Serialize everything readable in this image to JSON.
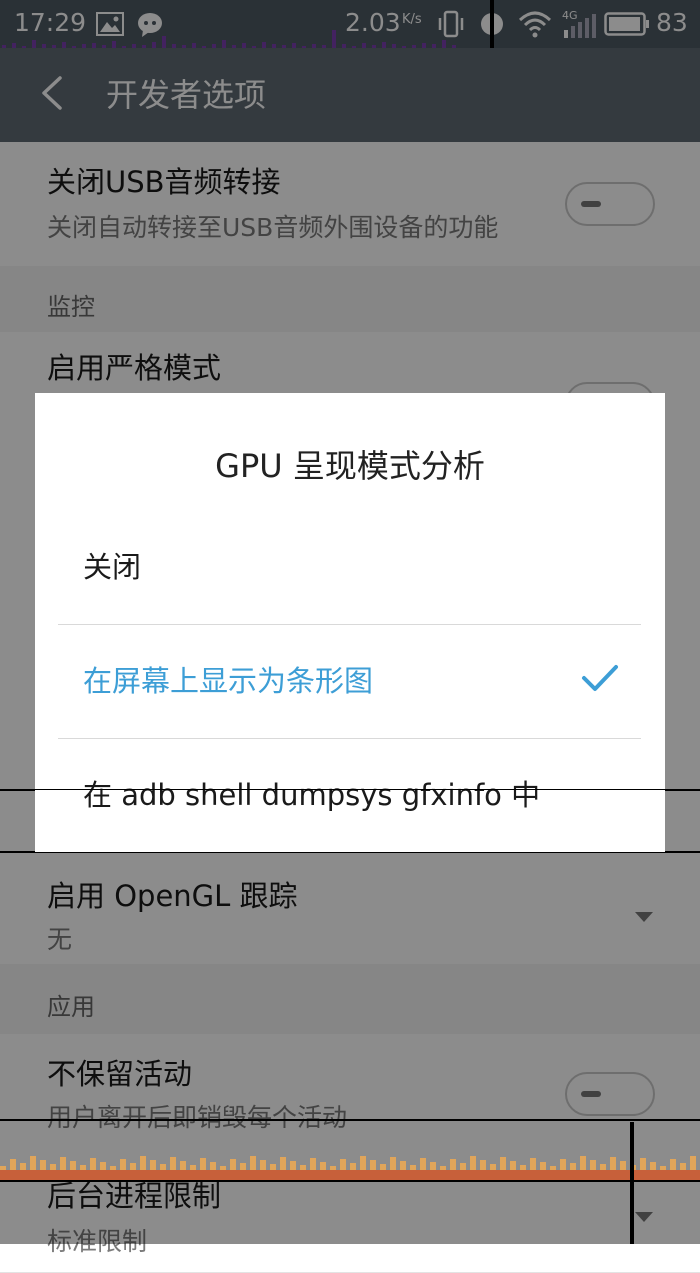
{
  "status_bar": {
    "time": "17:29",
    "net_speed": "2.03",
    "net_speed_unit": "K/s",
    "network_type": "4G",
    "battery_level": "83"
  },
  "app_bar": {
    "title": "开发者选项"
  },
  "settings": {
    "usb_audio": {
      "title": "关闭USB音频转接",
      "subtitle": "关闭自动转接至USB音频外围设备的功能"
    },
    "section_monitor": "监控",
    "strict_mode": {
      "title": "启用严格模式"
    },
    "opengl_trace": {
      "title": "启用 OpenGL 跟踪",
      "value": "无"
    },
    "section_apps": "应用",
    "dont_keep_activities": {
      "title": "不保留活动",
      "subtitle": "用户离开后即销毁每个活动"
    },
    "bg_process_limit": {
      "title": "后台进程限制",
      "value": "标准限制"
    }
  },
  "dialog": {
    "title": "GPU 呈现模式分析",
    "options": [
      {
        "label": "关闭"
      },
      {
        "label": "在屏幕上显示为条形图"
      },
      {
        "label": "在 adb shell dumpsys gfxinfo 中"
      }
    ],
    "selected_index": 1
  },
  "colors": {
    "accent": "#3d9ed6",
    "app_bar": "#5f6a74",
    "status_bar": "#4e5963"
  }
}
